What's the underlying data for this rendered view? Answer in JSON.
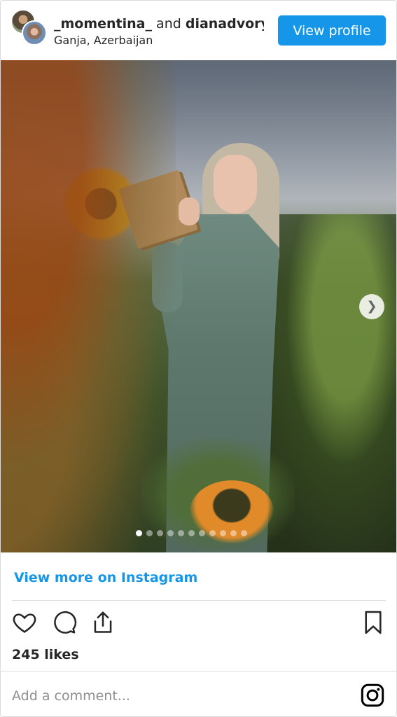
{
  "header": {
    "user1": "_momentina_",
    "connector": " and ",
    "user2": "dianadvoryanova",
    "location": "Ganja, Azerbaijan",
    "view_profile_label": "View profile"
  },
  "media": {
    "carousel_total": 11,
    "carousel_active_index": 0,
    "next_icon": "chevron-right-icon"
  },
  "footer": {
    "view_more_label": "View more on Instagram",
    "likes": "245 likes",
    "comment_placeholder": "Add a comment...",
    "icons": [
      "heart-icon",
      "comment-icon",
      "share-icon",
      "bookmark-icon",
      "instagram-icon"
    ]
  },
  "colors": {
    "accent": "#1596e8",
    "text": "#262626",
    "muted": "#8e8e8e",
    "border": "#dbdbdb"
  }
}
